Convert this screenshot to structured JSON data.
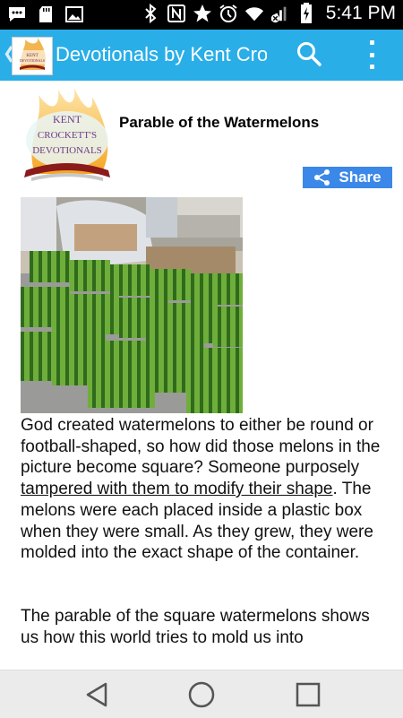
{
  "status_bar": {
    "time": "5:41 PM",
    "icons": [
      "chat-icon",
      "sd-card-icon",
      "gallery-icon",
      "bluetooth-icon",
      "nfc-icon",
      "star-icon",
      "alarm-icon",
      "wifi-icon",
      "signal-icon",
      "battery-charging-icon"
    ]
  },
  "app_bar": {
    "title": "Devotionals by Kent Crockett",
    "actions": [
      "search-icon",
      "overflow-menu-icon"
    ],
    "color": "#29aee8"
  },
  "post": {
    "logo_text": [
      "KENT",
      "CROCKETT'S",
      "DEVOTIONALS"
    ],
    "title": "Parable of the Watermelons",
    "share_label": "Share",
    "paragraph1_part1": "God created watermelons to either be round or football-shaped, so how did those melons in the picture become square? Someone purposely ",
    "paragraph1_link": "tampered with them to modify their shape",
    "paragraph1_part2": ". The melons were each placed inside a plastic box when they were small. As they grew, they were molded into the exact shape of the container.",
    "paragraph2": "The parable of the square watermelons shows us how this world tries to mold us into"
  },
  "nav_bar": {
    "buttons": [
      "back-icon",
      "home-icon",
      "recents-icon"
    ]
  }
}
